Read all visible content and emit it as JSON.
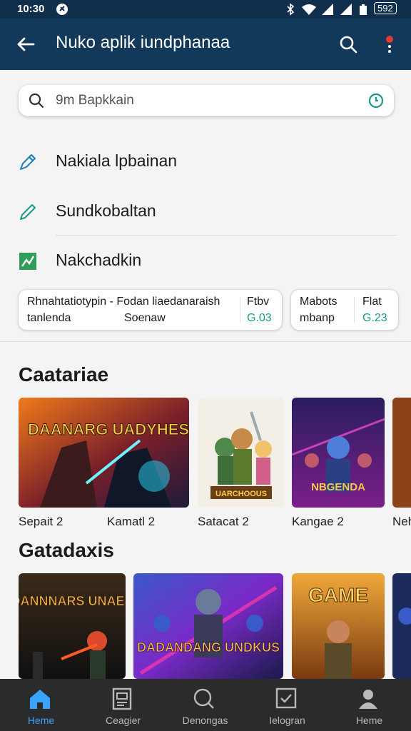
{
  "status_bar": {
    "time": "10:30",
    "battery": "592"
  },
  "app_bar": {
    "title": "Nuko aplik iundphanaa"
  },
  "search": {
    "placeholder": "9m Bapkkain"
  },
  "menu": [
    {
      "label": "Nakiala lpbainan",
      "icon": "pencil-icon"
    },
    {
      "label": "Sundkobaltan",
      "icon": "edit-icon"
    },
    {
      "label": "Nakchadkin",
      "icon": "chart-icon"
    }
  ],
  "cards": [
    {
      "line1": "Rhnahtatiotypin - Fodan liaedanaraish",
      "line2": "tanlenda",
      "line3": "Soenaw",
      "right_label": "Ftbv",
      "right_value": "G.03"
    },
    {
      "line1": "Mabots",
      "line2": "mbanp",
      "right_label": "Flat",
      "right_value": "G.23"
    }
  ],
  "sections": [
    {
      "title": "Caatariae",
      "items": [
        {
          "art_title": "DAANARG UADYHES",
          "label": "Sepait 2"
        },
        {
          "art_title": "UARCHOOUS",
          "label": "Kamatl 2"
        },
        {
          "art_title": "",
          "label": "Satacat 2"
        },
        {
          "art_title": "NBGENDA",
          "label": "Kangae 2"
        },
        {
          "art_title": "",
          "label": "Neh"
        }
      ]
    },
    {
      "title": "Gatadaxis",
      "items": [
        {
          "art_title": "DANNNARS UNAES"
        },
        {
          "art_title": "DADANDANG UNDKUS"
        },
        {
          "art_title": "GAME"
        },
        {
          "art_title": ""
        }
      ]
    }
  ],
  "bottom_nav": [
    {
      "label": "Heme",
      "icon": "home-icon",
      "active": true
    },
    {
      "label": "Ceagier",
      "icon": "document-icon"
    },
    {
      "label": "Denongas",
      "icon": "search-icon"
    },
    {
      "label": "Ielogran",
      "icon": "check-box-icon"
    },
    {
      "label": "Heme",
      "icon": "profile-icon"
    }
  ],
  "colors": {
    "app_bar": "#12385a",
    "status_bar": "#0f2f4c",
    "accent": "#3aa3ff",
    "teal": "#1a9a8a",
    "notification_dot": "#e53935"
  }
}
